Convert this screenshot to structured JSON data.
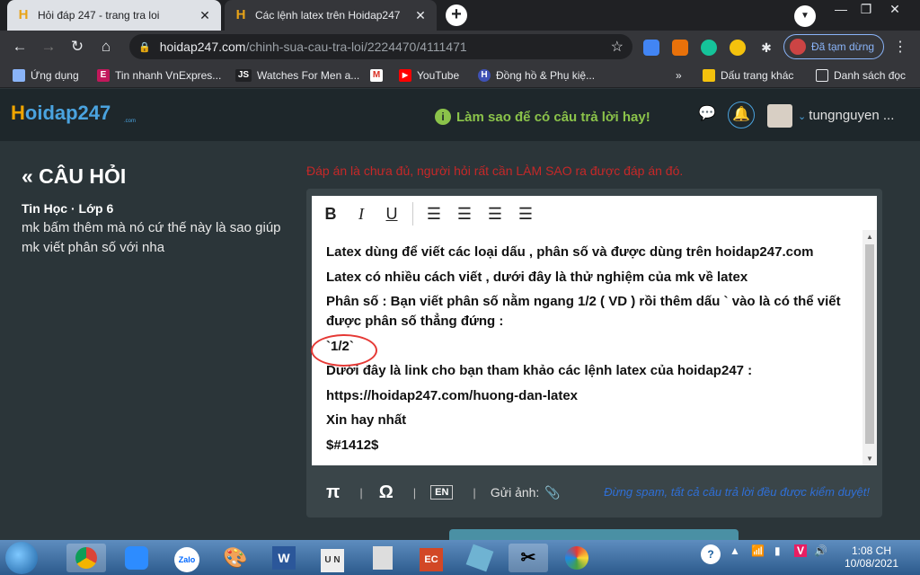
{
  "browser": {
    "tabs": [
      {
        "title": "Hỏi đáp 247 - trang tra loi",
        "active": false
      },
      {
        "title": "Các lệnh latex trên Hoidap247",
        "active": true
      }
    ],
    "address": {
      "host": "hoidap247.com",
      "path": "/chinh-sua-cau-tra-loi/2224470/4111471"
    },
    "profile_status": "Đã tạm dừng",
    "bookmarks": [
      {
        "label": "Ứng dụng",
        "icon": "apps-icon"
      },
      {
        "label": "Tin nhanh VnExpres...",
        "icon": "vnexpress-icon"
      },
      {
        "label": "Watches For Men a...",
        "icon": "js-icon"
      },
      {
        "label": "",
        "icon": "gmail-icon"
      },
      {
        "label": "YouTube",
        "icon": "youtube-icon"
      },
      {
        "label": "Đồng hồ & Phụ kiệ...",
        "icon": "watch-shop-icon"
      }
    ],
    "bookmarks_more": "»",
    "other_bookmarks": "Dấu trang khác",
    "reading_list": "Danh sách đọc"
  },
  "site": {
    "logo_main": "oidap247",
    "logo_h": "H",
    "logo_sub": ".com",
    "help_text": "Làm sao để có câu trả lời hay!",
    "username": "tungnguyen ..."
  },
  "question": {
    "heading": "« CÂU HỎI",
    "meta": "Tin Học · Lớp 6",
    "body": "mk bấm thêm mà nó cứ thế này là sao giúp mk viết phân số với nha"
  },
  "warning": "Đáp án là chưa đủ, người hỏi rất cần LÀM SAO ra được đáp án đó.",
  "editor": {
    "toolbar": [
      "B",
      "I",
      "U"
    ],
    "content": [
      "Latex dùng để viết các loại dấu , phân số và được dùng trên hoidap247.com",
      "Latex có nhiều cách viết , dưới đây là thử nghiệm của mk về latex",
      "Phân số : Bạn viết phân số nằm ngang 1/2 ( VD ) rồi thêm dấu ` vào là có thể viết được phân số thẳng đứng :",
      "`1/2`",
      "Dưới đây là link cho bạn tham khảo các lệnh latex của hoidap247 :",
      "https://hoidap247.com/huong-dan-latex",
      "Xin hay nhất",
      "$#1412$"
    ],
    "footer": {
      "pi": "π",
      "omega": "Ω",
      "upload_label": "Gửi ảnh:",
      "note": "Đừng spam, tất cả câu trả lời đều được kiểm duyệt!"
    }
  },
  "taskbar": {
    "time": "1:08 CH",
    "date": "10/08/2021"
  }
}
